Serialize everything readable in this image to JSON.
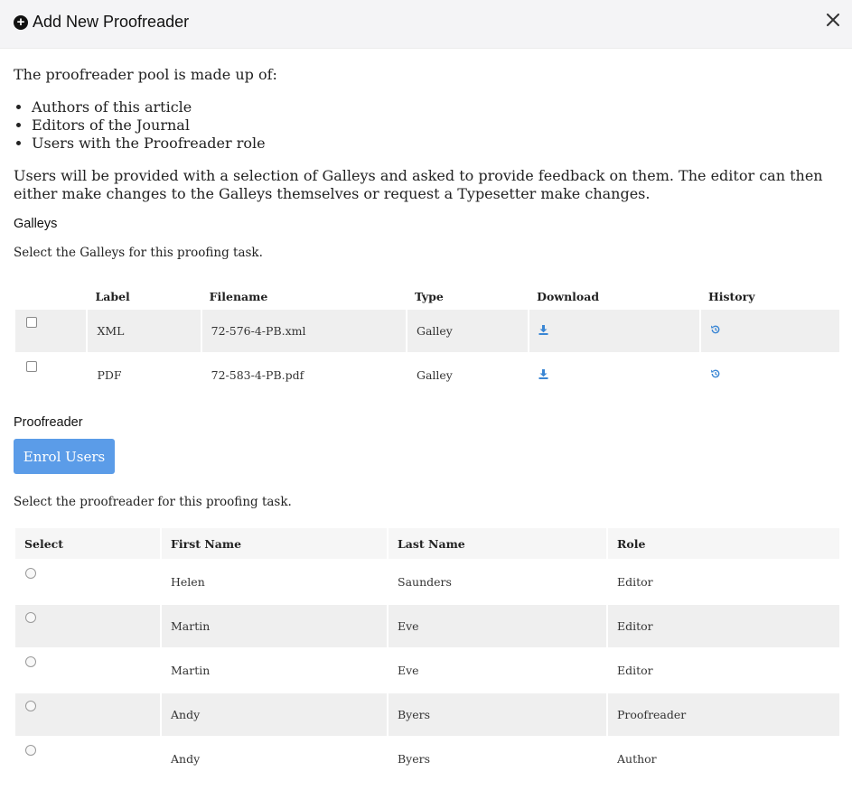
{
  "modal": {
    "title": "Add New Proofreader"
  },
  "intro": {
    "pool_text": "The proofreader pool is made up of:",
    "pool_items": [
      "Authors of this article",
      "Editors of the Journal",
      "Users with the Proofreader role"
    ],
    "description": "Users will be provided with a selection of Galleys and asked to provide feedback on them. The editor can then either make changes to the Galleys themselves or request a Typesetter make changes."
  },
  "galleys": {
    "heading": "Galleys",
    "instruction": "Select the Galleys for this proofing task.",
    "columns": [
      "Label",
      "Filename",
      "Type",
      "Download",
      "History"
    ],
    "rows": [
      {
        "label": "XML",
        "filename": "72-576-4-PB.xml",
        "type": "Galley",
        "checked": false
      },
      {
        "label": "PDF",
        "filename": "72-583-4-PB.pdf",
        "type": "Galley",
        "checked": false
      }
    ]
  },
  "proofreader": {
    "heading": "Proofreader",
    "enrol_button": "Enrol Users",
    "instruction": "Select the proofreader for this proofing task.",
    "columns": [
      "Select",
      "First Name",
      "Last Name",
      "Role"
    ],
    "rows": [
      {
        "first": "Helen",
        "last": "Saunders",
        "role": "Editor"
      },
      {
        "first": "Martin",
        "last": "Eve",
        "role": "Editor"
      },
      {
        "first": "Martin",
        "last": "Eve",
        "role": "Editor"
      },
      {
        "first": "Andy",
        "last": "Byers",
        "role": "Proofreader"
      },
      {
        "first": "Andy",
        "last": "Byers",
        "role": "Author"
      }
    ]
  },
  "colors": {
    "accent": "#5b9ce8",
    "icon_blue": "#3a86d4",
    "header_bg": "#f4f4f6",
    "row_shade": "#efefef"
  },
  "icons": {
    "title": "plus-circle-icon",
    "close": "close-icon",
    "download": "download-icon",
    "history": "history-icon"
  }
}
